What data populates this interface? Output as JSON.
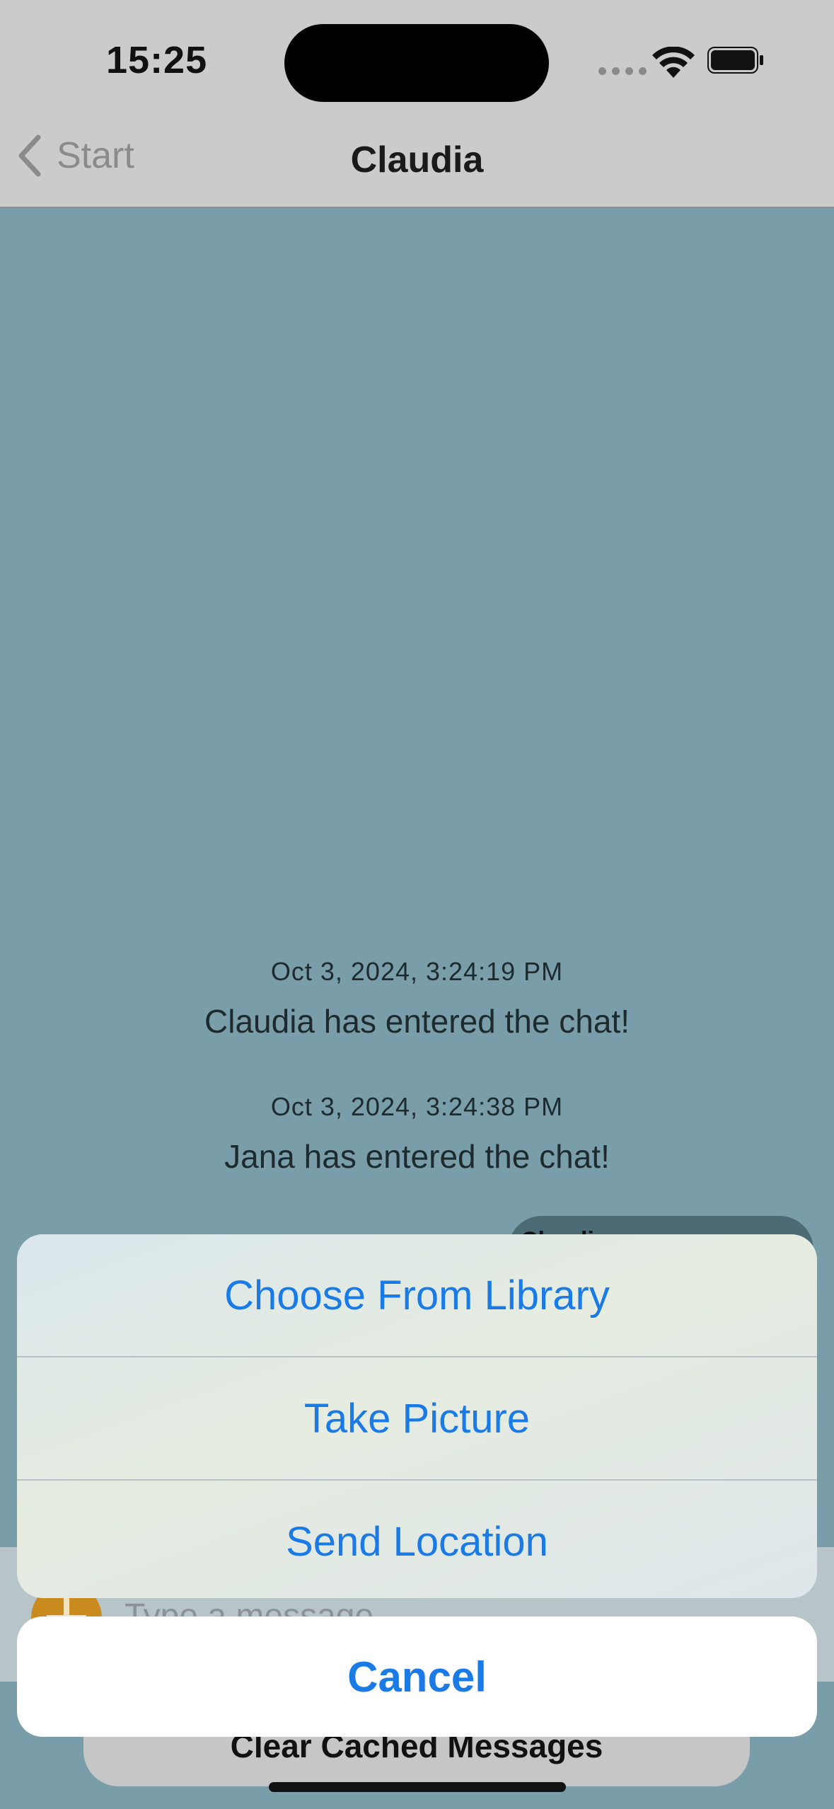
{
  "status_bar": {
    "time": "15:25"
  },
  "nav": {
    "back_label": "Start",
    "title": "Claudia"
  },
  "chat": {
    "system_messages": [
      {
        "timestamp": "Oct 3, 2024, 3:24:19 PM",
        "text": "Claudia has entered the chat!"
      },
      {
        "timestamp": "Oct 3, 2024, 3:24:38 PM",
        "text": "Jana has entered the chat!"
      }
    ],
    "partial_bubble_label": "Claudia"
  },
  "input": {
    "placeholder": "Type a message..."
  },
  "clear_button": {
    "label": "Clear Cached Messages"
  },
  "action_sheet": {
    "options": [
      "Choose From Library",
      "Take Picture",
      "Send Location"
    ],
    "cancel_label": "Cancel"
  },
  "colors": {
    "background": "#7a9ea9",
    "accent": "#1a7ae6",
    "plus_button": "#c98a1e"
  }
}
